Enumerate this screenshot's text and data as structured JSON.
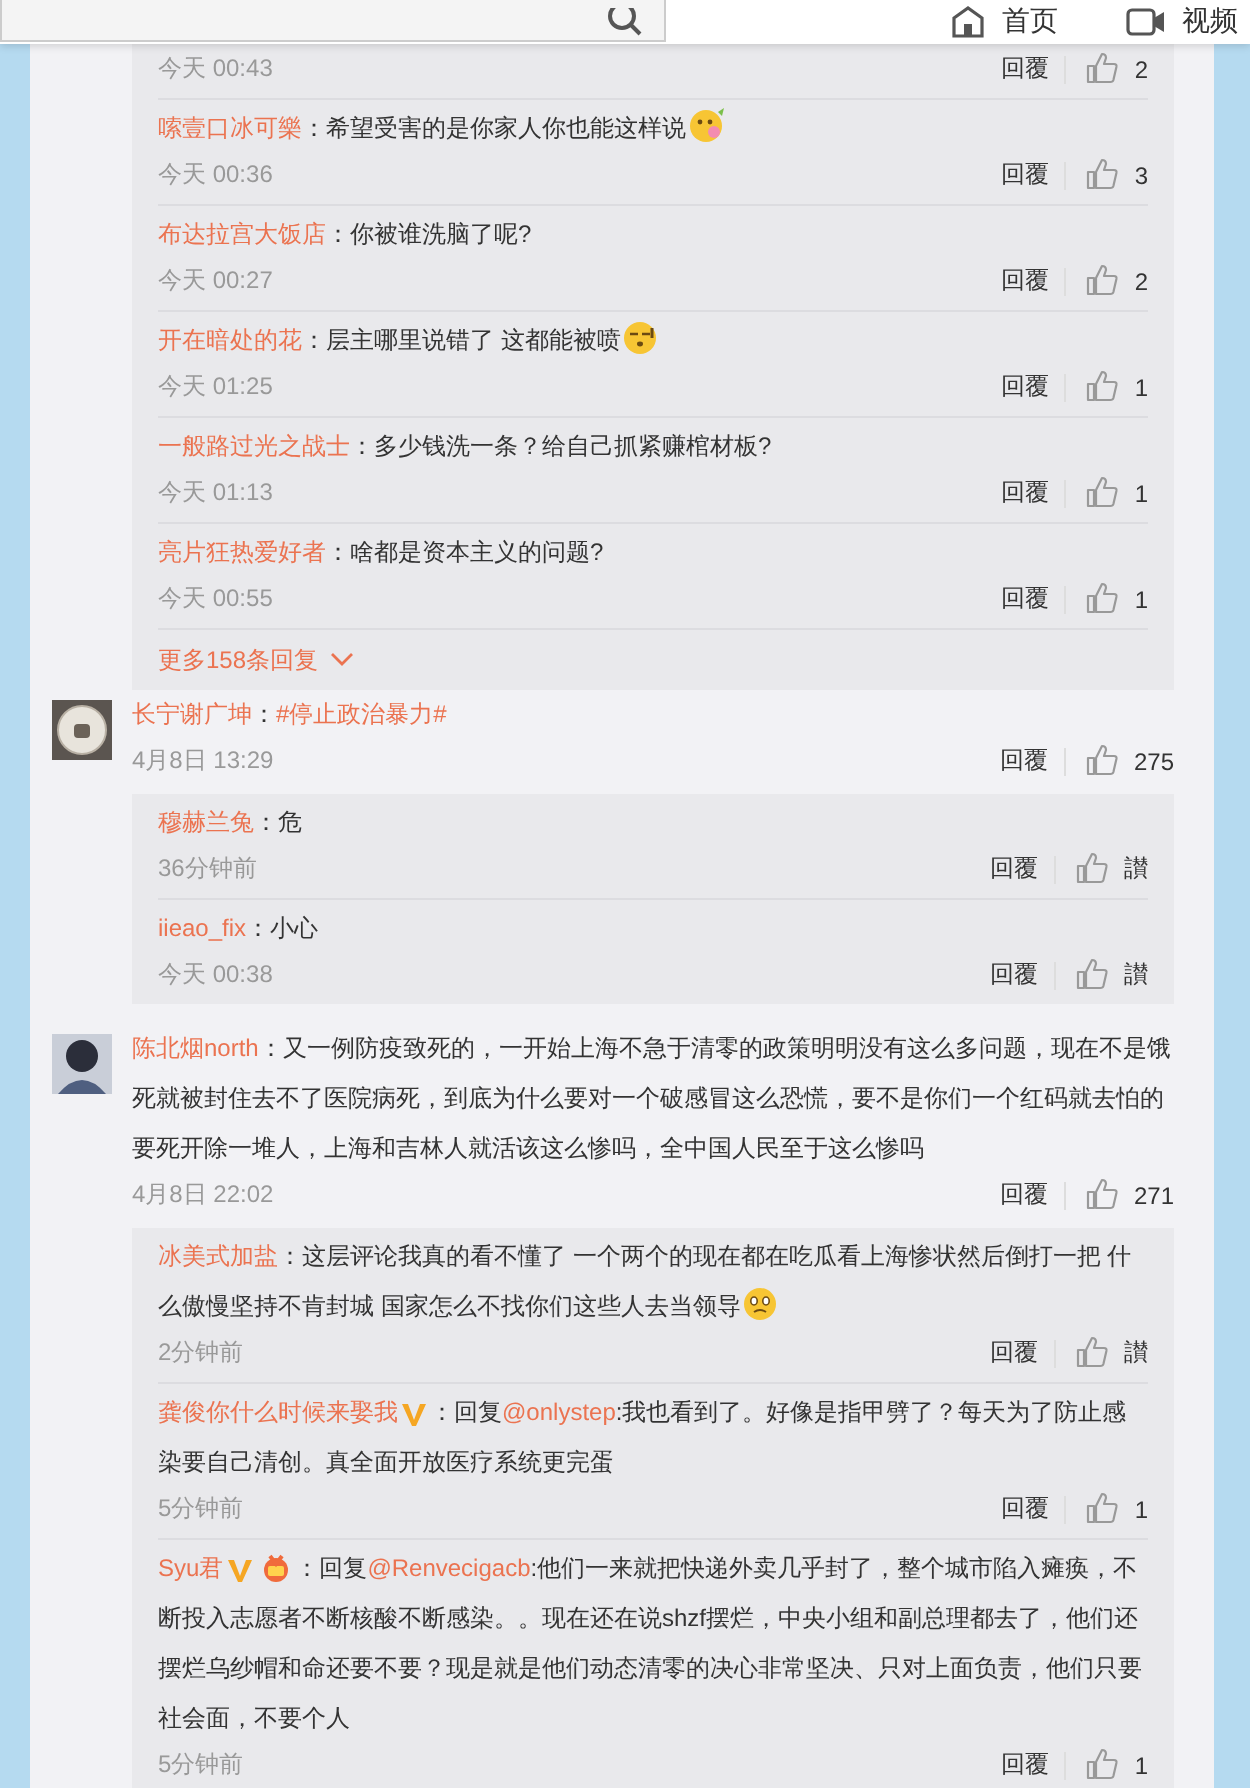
{
  "header": {
    "nav": [
      {
        "kind": "home",
        "label": "首页"
      },
      {
        "kind": "video",
        "label": "视频"
      }
    ]
  },
  "threads": [
    {
      "replies": [
        {
          "time": "今天 00:43",
          "reply_label": "回覆",
          "likes": "2"
        },
        {
          "body": [
            {
              "kind": "author",
              "text": "嗦壹口冰可樂"
            },
            {
              "kind": "text",
              "text": "：希望受害的是你家人你也能这样说"
            },
            {
              "kind": "flower_emoji"
            }
          ],
          "time": "今天 00:36",
          "reply_label": "回覆",
          "likes": "3"
        },
        {
          "body": [
            {
              "kind": "author",
              "text": "布达拉宫大饭店"
            },
            {
              "kind": "text",
              "text": "：你被谁洗脑了呢?"
            }
          ],
          "time": "今天 00:27",
          "reply_label": "回覆",
          "likes": "2"
        },
        {
          "body": [
            {
              "kind": "author",
              "text": "开在暗处的花"
            },
            {
              "kind": "text",
              "text": "：层主哪里说错了 这都能被喷"
            },
            {
              "kind": "sweat_emoji"
            }
          ],
          "time": "今天 01:25",
          "reply_label": "回覆",
          "likes": "1"
        },
        {
          "body": [
            {
              "kind": "author",
              "text": "一般路过光之战士"
            },
            {
              "kind": "text",
              "text": "：多少钱洗一条？给自己抓紧赚棺材板?"
            }
          ],
          "time": "今天 01:13",
          "reply_label": "回覆",
          "likes": "1"
        },
        {
          "body": [
            {
              "kind": "author",
              "text": "亮片狂热爱好者"
            },
            {
              "kind": "text",
              "text": "：啥都是资本主义的问题?"
            }
          ],
          "time": "今天 00:55",
          "reply_label": "回覆",
          "likes": "1"
        }
      ],
      "more": "更多158条回复"
    },
    {
      "comment": {
        "avatar": {
          "kind": "badge"
        },
        "body": [
          {
            "kind": "author",
            "text": "长宁谢广坤"
          },
          {
            "kind": "text",
            "text": "："
          },
          {
            "kind": "link",
            "text": "#停止政治暴力#"
          }
        ],
        "time": "4月8日 13:29",
        "reply_label": "回覆",
        "likes": "275"
      },
      "replies": [
        {
          "body": [
            {
              "kind": "author",
              "text": "穆赫兰兔"
            },
            {
              "kind": "text",
              "text": "：危"
            }
          ],
          "time": "36分钟前",
          "reply_label": "回覆",
          "likes": "讃"
        },
        {
          "body": [
            {
              "kind": "author",
              "text": "iieao_fix"
            },
            {
              "kind": "text",
              "text": "：小心"
            }
          ],
          "time": "今天 00:38",
          "reply_label": "回覆",
          "likes": "讃"
        }
      ]
    },
    {
      "comment": {
        "avatar": {
          "kind": "person"
        },
        "body": [
          {
            "kind": "author",
            "text": "陈北烟north"
          },
          {
            "kind": "text",
            "text": "：又一例防疫致死的，一开始上海不急于清零的政策明明没有这么多问题，现在不是饿死就被封住去不了医院病死，到底为什么要对一个破感冒这么恐慌，要不是你们一个红码就去怕的要死开除一堆人，上海和吉林人就活该这么惨吗，全中国人民至于这么惨吗"
          }
        ],
        "time": "4月8日 22:02",
        "reply_label": "回覆",
        "likes": "271"
      },
      "replies": [
        {
          "body": [
            {
              "kind": "author",
              "text": "冰美式加盐"
            },
            {
              "kind": "text",
              "text": "：这层评论我真的看不懂了 一个两个的现在都在吃瓜看上海惨状然后倒打一把 什么傲慢坚持不肯封城 国家怎么不找你们这些人去当领导"
            },
            {
              "kind": "sad_emoji"
            }
          ],
          "time": "2分钟前",
          "reply_label": "回覆",
          "likes": "讃"
        },
        {
          "body": [
            {
              "kind": "author",
              "text": "龚俊你什么时候来娶我"
            },
            {
              "kind": "v_badge"
            },
            {
              "kind": "text",
              "text": "：回复"
            },
            {
              "kind": "mention",
              "text": "@onlystep"
            },
            {
              "kind": "text",
              "text": ":我也看到了。好像是指甲劈了？每天为了防止感染要自己清创。真全面开放医疗系统更完蛋"
            }
          ],
          "time": "5分钟前",
          "reply_label": "回覆",
          "likes": "1"
        },
        {
          "body": [
            {
              "kind": "author",
              "text": "Syu君"
            },
            {
              "kind": "v_badge"
            },
            {
              "kind": "medal_badge"
            },
            {
              "kind": "text",
              "text": "：回复"
            },
            {
              "kind": "mention",
              "text": "@Renvecigacb"
            },
            {
              "kind": "text",
              "text": ":他们一来就把快递外卖几乎封了，整个城市陷入瘫痪，不断投入志愿者不断核酸不断感染。。现在还在说shzf摆烂，中央小组和副总理都去了，他们还摆烂乌纱帽和命还要不要？现是就是他们动态清零的决心非常坚决、只对上面负责，他们只要社会面，不要个人"
            }
          ],
          "time": "5分钟前",
          "reply_label": "回覆",
          "likes": "1"
        }
      ]
    }
  ]
}
